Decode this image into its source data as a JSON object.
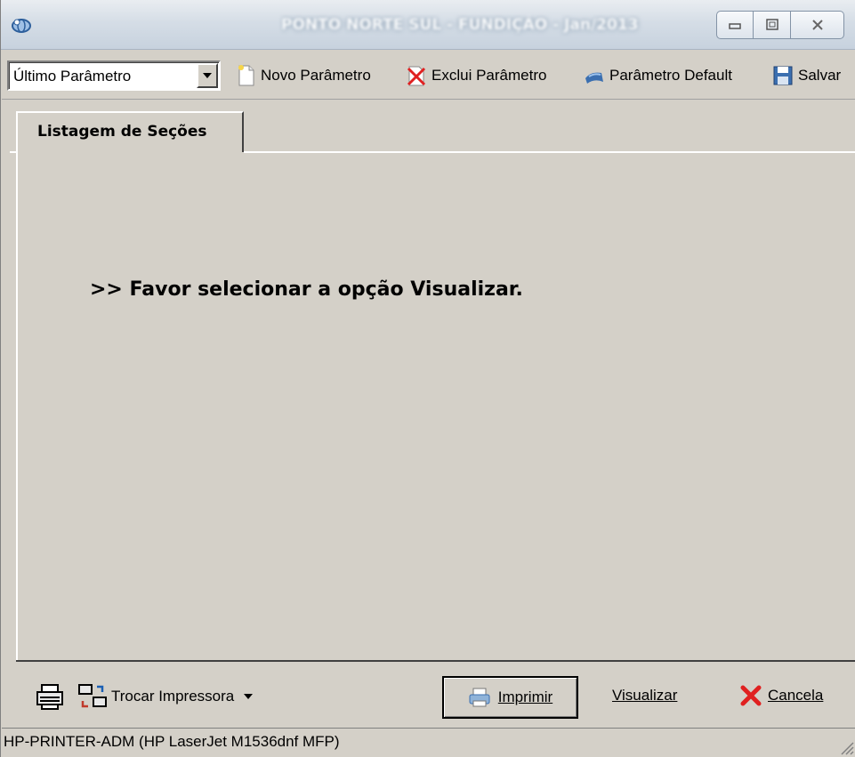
{
  "window": {
    "title": "PONTO NORTE SUL - FUNDIÇÃO - Jan/2013",
    "icons": {
      "app": "app-logo-icon",
      "minimize": "minimize-icon",
      "maximize": "maximize-icon",
      "close": "close-icon"
    }
  },
  "toolbar": {
    "combo_value": "Último Parâmetro",
    "new_label": "Novo Parâmetro",
    "delete_label": "Exclui Parâmetro",
    "default_label": "Parâmetro Default",
    "save_label": "Salvar"
  },
  "tabs": [
    {
      "label": "Listagem de Seções",
      "active": true
    }
  ],
  "main": {
    "message": ">>  Favor selecionar a opção Visualizar."
  },
  "bottom": {
    "change_printer_label": "Trocar Impressora",
    "print_label": "Imprimir",
    "preview_label": "Visualizar",
    "cancel_label": "Cancela"
  },
  "status": {
    "printer": "HP-PRINTER-ADM (HP LaserJet M1536dnf MFP)"
  },
  "colors": {
    "face": "#d4d0c8",
    "cancel_red": "#e02020",
    "toolbar_blue": "#3b6fb0"
  }
}
